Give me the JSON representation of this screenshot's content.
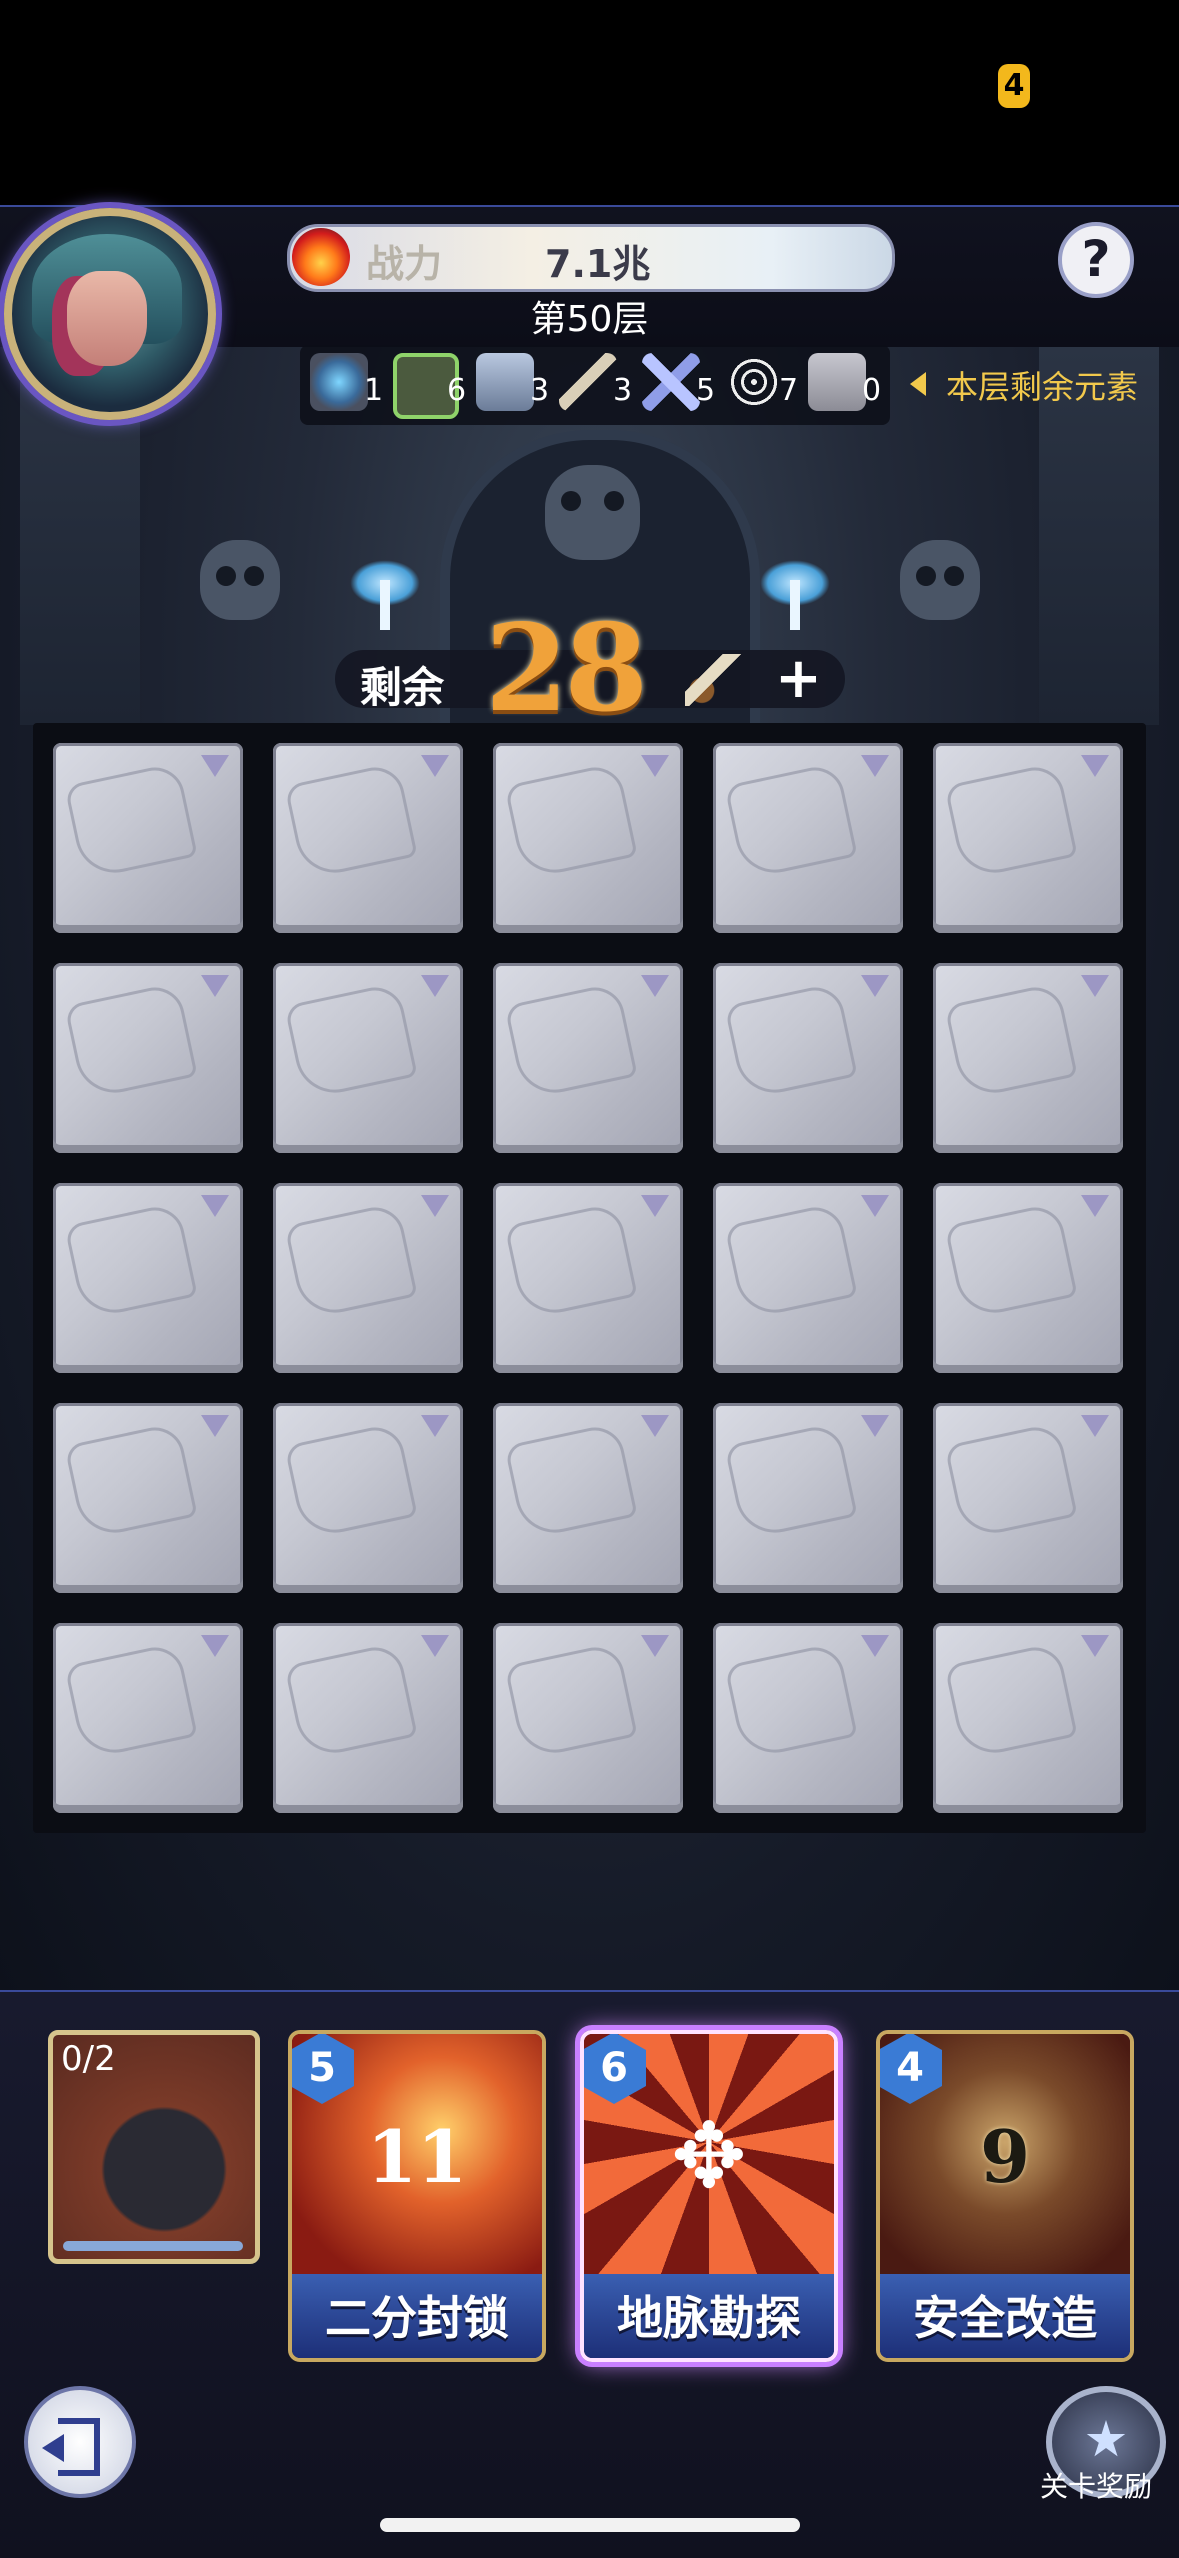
{
  "status": {
    "chip_text": "4"
  },
  "header": {
    "power_label": "战力",
    "power_value": "7.1兆",
    "floor": "第50层",
    "help_label": "?"
  },
  "elements": {
    "items": [
      {
        "icon": "tombstone-icon",
        "count": "1"
      },
      {
        "icon": "blocked-icon",
        "count": "6"
      },
      {
        "icon": "chest-icon",
        "count": "3"
      },
      {
        "icon": "shovel-icon",
        "count": "3"
      },
      {
        "icon": "crossed-swords-icon",
        "count": "5"
      },
      {
        "icon": "spider-web-icon",
        "count": "7"
      },
      {
        "icon": "puzzle-piece-icon",
        "count": "0"
      }
    ],
    "legend": "本层剩余元素"
  },
  "remaining": {
    "label": "剩余",
    "count": "28",
    "plus": "+"
  },
  "grid": {
    "rows": 5,
    "cols": 5
  },
  "bomb": {
    "counter": "0/2"
  },
  "skills": [
    {
      "name": "二分封锁",
      "cost": "5",
      "number": "11",
      "selected": false
    },
    {
      "name": "地脉勘探",
      "cost": "6",
      "number": "",
      "selected": true
    },
    {
      "name": "安全改造",
      "cost": "4",
      "number": "9",
      "selected": false
    }
  ],
  "footer": {
    "reward_label": "关卡奖励"
  }
}
